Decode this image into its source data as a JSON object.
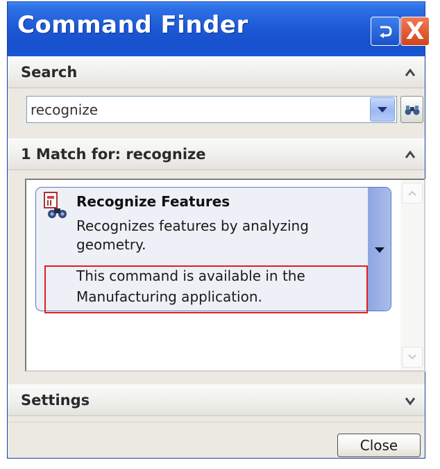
{
  "window": {
    "title": "Command Finder"
  },
  "titlebar_buttons": {
    "rollback_icon": "rollback-arrow-icon",
    "close_icon": "close-x-icon",
    "close_glyph": "X"
  },
  "search_section": {
    "label": "Search",
    "query": "recognize"
  },
  "results_section": {
    "label": "1 Match for: recognize",
    "results": [
      {
        "title": "Recognize Features",
        "description": "Recognizes features by analyzing geometry.",
        "availability": "This command is available in the Manufacturing application."
      }
    ]
  },
  "settings_section": {
    "label": "Settings"
  },
  "footer": {
    "close_label": "Close"
  },
  "colors": {
    "titlebar": "#1e5bd8",
    "highlight": "#e11d1d",
    "card_border": "#5b76c5"
  }
}
